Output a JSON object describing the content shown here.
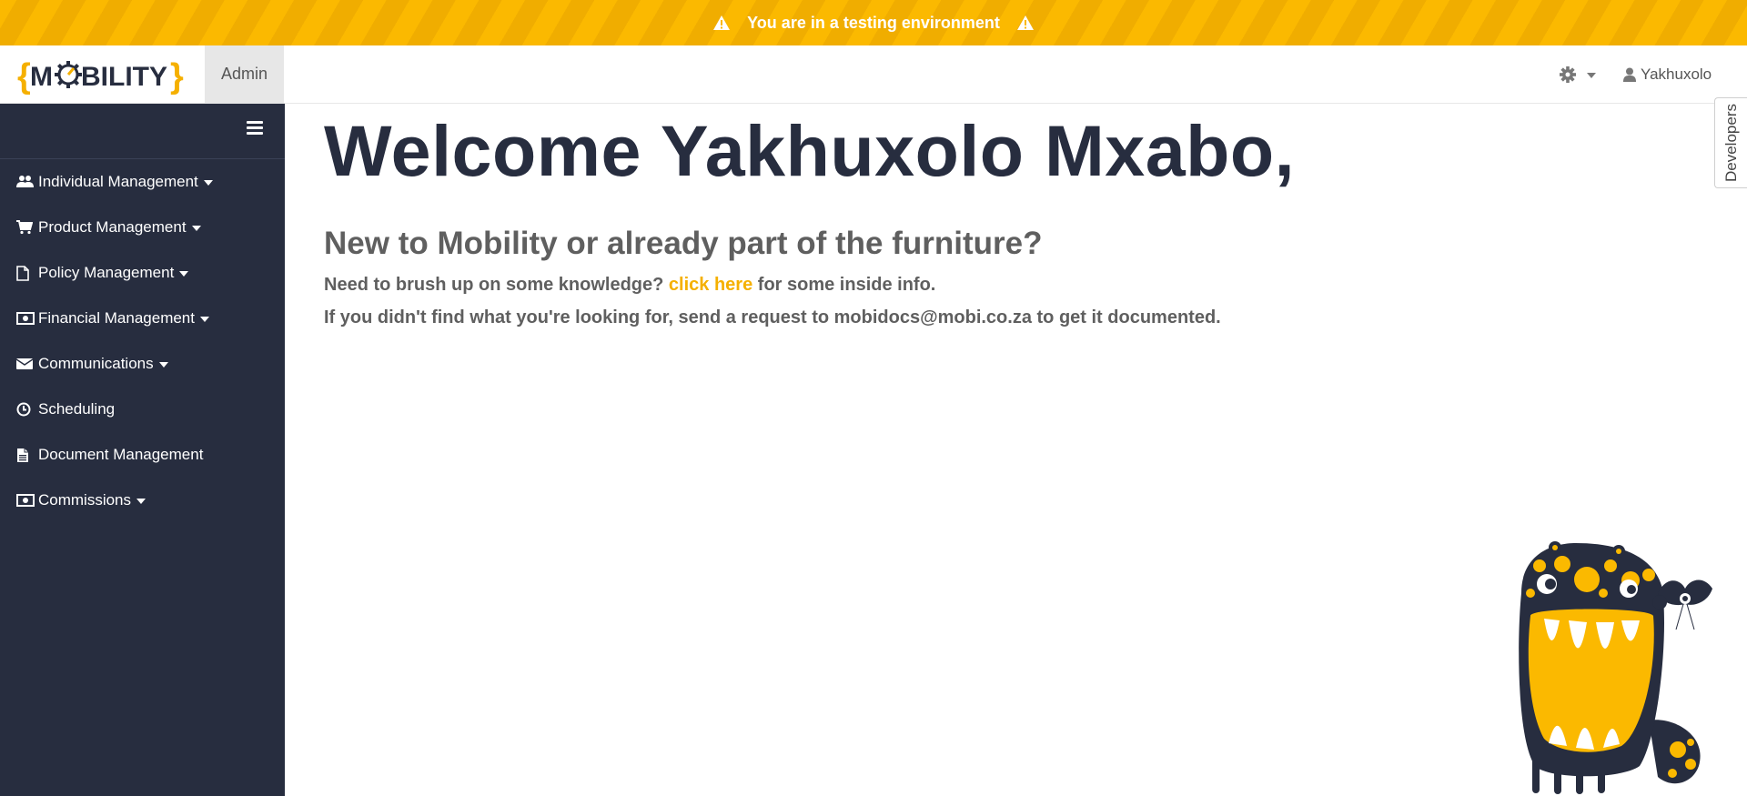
{
  "banner": {
    "text": "You are in a testing environment",
    "icon": "warning-icon"
  },
  "logo": {
    "text_left": "{M",
    "text_right": "BILITY}"
  },
  "header": {
    "admin_tab": "Admin",
    "settings_icon": "gear-icon",
    "user_name": "Yakhuxolo",
    "user_icon": "user-icon",
    "developers_tab": "Developers"
  },
  "sidebar": {
    "items": [
      {
        "label": "Individual Management",
        "icon": "users-icon",
        "dropdown": true
      },
      {
        "label": "Product Management",
        "icon": "shopping-cart-icon",
        "dropdown": true
      },
      {
        "label": "Policy Management",
        "icon": "file-icon",
        "dropdown": true
      },
      {
        "label": "Financial Management",
        "icon": "money-icon",
        "dropdown": true
      },
      {
        "label": "Communications",
        "icon": "envelope-icon",
        "dropdown": true
      },
      {
        "label": "Scheduling",
        "icon": "clock-icon",
        "dropdown": false
      },
      {
        "label": "Document Management",
        "icon": "file-text-icon",
        "dropdown": false
      },
      {
        "label": "Commissions",
        "icon": "money-icon",
        "dropdown": true
      }
    ]
  },
  "main": {
    "welcome": "Welcome Yakhuxolo Mxabo,",
    "subtitle": "New to Mobility or already part of the furniture?",
    "line1_before": "Need to brush up on some knowledge?",
    "line1_link": "click here",
    "line1_after": "for some inside info.",
    "line2": "If you didn't find what you're looking for, send a request to mobidocs@mobi.co.za to get it documented."
  },
  "colors": {
    "banner": "#fbb900",
    "sidebar": "#272d3f",
    "heading": "#272d3f",
    "text": "#5f5f5f",
    "link": "#f5b000"
  }
}
